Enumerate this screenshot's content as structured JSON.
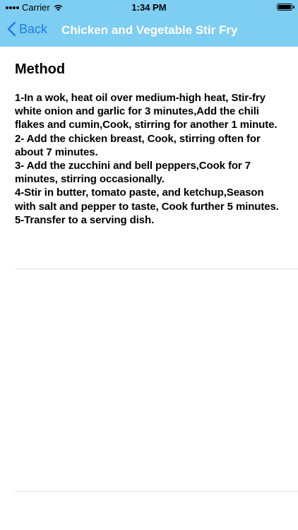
{
  "status_bar": {
    "carrier": "Carrier",
    "time": "1:34 PM"
  },
  "nav": {
    "back_label": "Back",
    "title": "Chicken and Vegetable Stir Fry"
  },
  "content": {
    "section_title": "Method",
    "method_text": "1-In a wok, heat oil over medium-high heat, Stir-fry white onion and garlic for 3 minutes,Add the chili flakes and cumin,Cook, stirring for another 1 minute.\n2- Add the chicken breast, Cook, stirring often for about 7 minutes.\n3- Add the zucchini and bell peppers,Cook for 7 minutes, stirring occasionally.\n4-Stir in butter, tomato paste, and ketchup,Season with salt and pepper to taste, Cook further 5 minutes.\n5-Transfer to a serving dish."
  },
  "colors": {
    "nav_background": "#7ecdf2",
    "back_tint": "#1e7fe6",
    "title_color": "#ffffff"
  },
  "icons": {
    "signal": "signal-dots-icon",
    "wifi": "wifi-icon",
    "battery": "battery-icon",
    "back": "chevron-left-icon"
  }
}
